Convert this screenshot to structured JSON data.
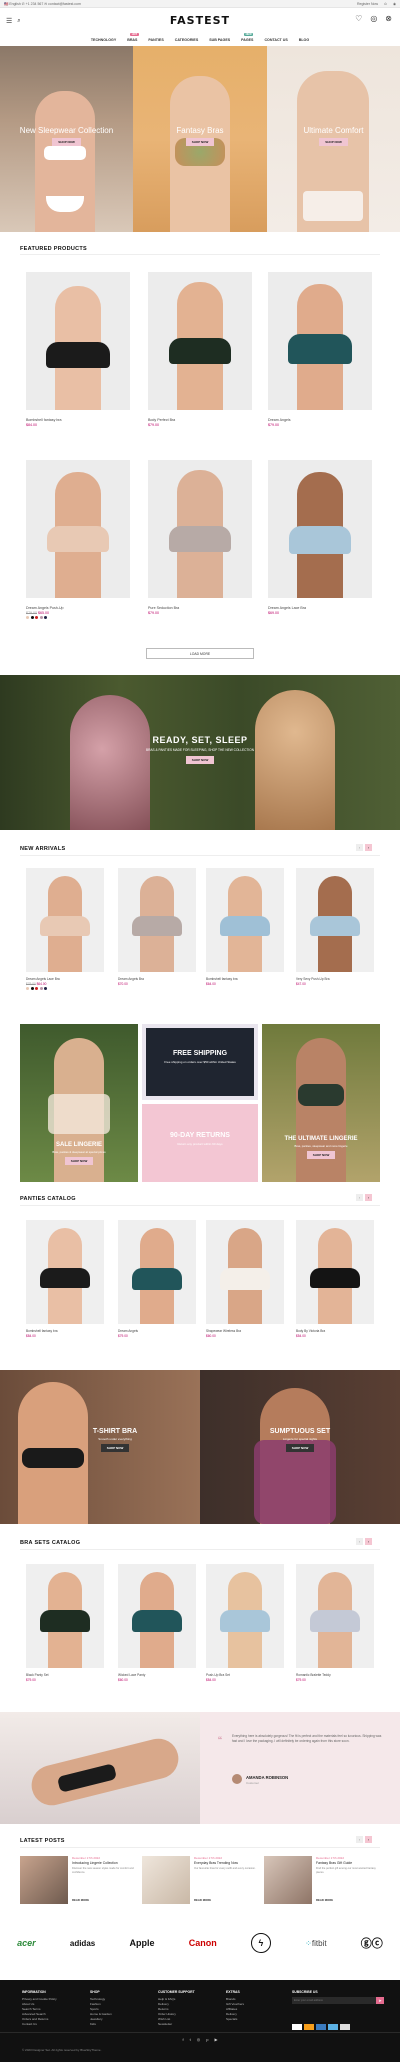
{
  "topbar": {
    "left": "🇺🇸 English  ✆ +1 234 567  ✉ contact@fastest.com",
    "right": [
      "Register Now",
      "⊙",
      "◉"
    ]
  },
  "brand": {
    "logo": "FASTEST"
  },
  "nav": [
    {
      "label": "TECHNOLOGY"
    },
    {
      "label": "BRAS",
      "badge": "HOT"
    },
    {
      "label": "PANTIES"
    },
    {
      "label": "CATEGORIES"
    },
    {
      "label": "SUB PAGES"
    },
    {
      "label": "PAGES",
      "badge": "NEW"
    },
    {
      "label": "CONTACT US"
    },
    {
      "label": "BLOG"
    }
  ],
  "banner": [
    {
      "title": "New Sleepwear Collection",
      "btn": "SHOP NOW"
    },
    {
      "title": "Fantasy Bras",
      "btn": "SHOP NOW"
    },
    {
      "title": "Ultimate Comfort",
      "btn": "SHOP NOW"
    }
  ],
  "featured": {
    "title": "FEATURED PRODUCTS",
    "items": [
      {
        "name": "Bombshell fantasy bra",
        "price": "$84.00"
      },
      {
        "name": "Body Perfect Bra",
        "price": "$79.00"
      },
      {
        "name": "Dream Angels",
        "price": "$79.00"
      },
      {
        "name": "Dream Angels Push-Up",
        "price": "$65.00",
        "old": "$79.00"
      },
      {
        "name": "Pure Seduction Bra",
        "price": "$79.00"
      },
      {
        "name": "Dream Angels Lace Bra",
        "price": "$69.00"
      }
    ],
    "btn": "LOAD MORE"
  },
  "sleep": {
    "title": "READY, SET, SLEEP",
    "text": "BRAS & PANTIES MADE FOR SLEEPING, SHOP THE NEW COLLECTION",
    "btn": "SHOP NOW"
  },
  "arrivals": {
    "title": "NEW ARRIVALS",
    "items": [
      {
        "name": "Dream Angels Lace Bra",
        "price": "$64.00",
        "old": "$79.00"
      },
      {
        "name": "Dream Angels Bra",
        "price": "$70.00"
      },
      {
        "name": "Bombshell fantasy bra",
        "price": "$64.00"
      },
      {
        "name": "Very Sexy Push-Up Bra",
        "price": "$47.00"
      }
    ]
  },
  "promo": {
    "left": {
      "title": "SALE LINGERIE",
      "text": "Bras, panties & sleepwear at special prices",
      "btn": "SHOP NOW"
    },
    "ship": {
      "title": "FREE SHIPPING",
      "text": "Free shipping on orders over $50 within United States"
    },
    "ret": {
      "title": "90-DAY RETURNS",
      "text": "Return any product within 90 days"
    },
    "right": {
      "title": "THE ULTIMATE LINGERIE",
      "text": "Bras, panties, sleepwear and more lingerie",
      "btn": "SHOP NOW"
    }
  },
  "panties": {
    "title": "PANTIES CATALOG",
    "items": [
      {
        "name": "Bombshell fantasy bra",
        "price": "$84.00"
      },
      {
        "name": "Dream Angels",
        "price": "$79.00"
      },
      {
        "name": "Shapewear Wireless Bra",
        "price": "$60.00"
      },
      {
        "name": "Body By Victoria Bra",
        "price": "$54.00"
      }
    ]
  },
  "duo": {
    "left": {
      "title": "T-SHIRT BRA",
      "text": "Smooth under everything",
      "btn": "SHOP NOW"
    },
    "right": {
      "title": "SUMPTUOUS SET",
      "text": "Lingerie for special nights",
      "btn": "SHOP NOW"
    }
  },
  "brasets": {
    "title": "BRA SETS CATALOG",
    "items": [
      {
        "name": "Black Panty Set",
        "price": "$79.00"
      },
      {
        "name": "Wicked Lace Panty",
        "price": "$60.00"
      },
      {
        "name": "Push-Up Bra Set",
        "price": "$84.00"
      },
      {
        "name": "Romantic Bralette Teddy",
        "price": "$79.00"
      }
    ]
  },
  "testimonial": {
    "quote": "Everything here is absolutely gorgeous! The fit is perfect and the materials feel so luxurious. Shipping was fast and I love the packaging. I will definitely be ordering again from this store soon.",
    "name": "AMANDA ROBINSON",
    "role": "Customer"
  },
  "posts": {
    "title": "LATEST POSTS",
    "items": [
      {
        "date": "December 17th 2022",
        "title": "Introducing Lingerie Collection",
        "text": "Discover the new season styles made for comfort and confidence.",
        "more": "READ MORE"
      },
      {
        "date": "December 17th 2022",
        "title": "Everyday Bras Trending Now",
        "text": "Our favourite bras for every outfit and every occasion.",
        "more": "READ MORE"
      },
      {
        "date": "December 17th 2022",
        "title": "Fantasy Bras Gift Guide",
        "text": "Find the perfect gift among our most wanted fantasy pieces.",
        "more": "READ MORE"
      }
    ]
  },
  "brands": [
    "acer",
    "adidas",
    "Apple",
    "Canon",
    "",
    "fitbit",
    "GUCCI"
  ],
  "footer": {
    "cols": [
      {
        "title": "INFORMATION",
        "links": [
          "Privacy and Cookie Policy",
          "About Us",
          "Search Terms",
          "Advanced Search",
          "Orders and Returns",
          "Contact Us"
        ]
      },
      {
        "title": "SHOP",
        "links": [
          "Technology",
          "Fashion",
          "Sports",
          "Home & Garden",
          "Jewellery",
          "Kids"
        ]
      },
      {
        "title": "CUSTOMER SUPPORT",
        "links": [
          "Help & FAQs",
          "Delivery",
          "Returns",
          "Order History",
          "Wish List",
          "Newsletter"
        ]
      },
      {
        "title": "EXTRAS",
        "links": [
          "Brands",
          "Gift Vouchers",
          "Affiliates",
          "Delivery",
          "Specials"
        ]
      },
      {
        "title": "SUBSCRIBE US",
        "links": [
          "Enter your email address"
        ]
      }
    ],
    "copyright": "© 2023 Designer Set. All rights reserved by BlueSkyTheme."
  },
  "colors": {
    "accent": "#e56b8f",
    "pink": "#f0c5d2",
    "dark": "#111111"
  }
}
